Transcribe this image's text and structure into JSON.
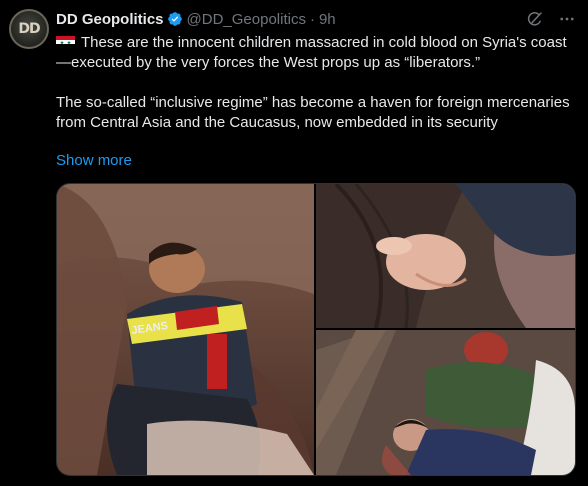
{
  "author": {
    "name": "DD Geopolitics",
    "handle": "@DD_Geopolitics",
    "time": "9h",
    "avatar_text": "DD"
  },
  "tweet": {
    "flag": "syria-flag",
    "line1": "These are the innocent children massacred in cold blood on Syria's coast—executed by the very forces the West props up as “liberators.”",
    "line2": "The so-called “inclusive regime” has become a haven for foreign mercenaries from Central Asia and the Caucasus, now embedded in its security",
    "show_more": "Show more"
  },
  "media": {
    "count": 3,
    "jacket_text": "JEANS"
  },
  "icons": {
    "verified": "verified-badge-icon",
    "grok": "grok-icon",
    "more": "more-dots-icon"
  },
  "colors": {
    "link": "#1d9bf0",
    "verified": "#1d9bf0",
    "secondary_text": "#71767b",
    "background": "#000000"
  }
}
